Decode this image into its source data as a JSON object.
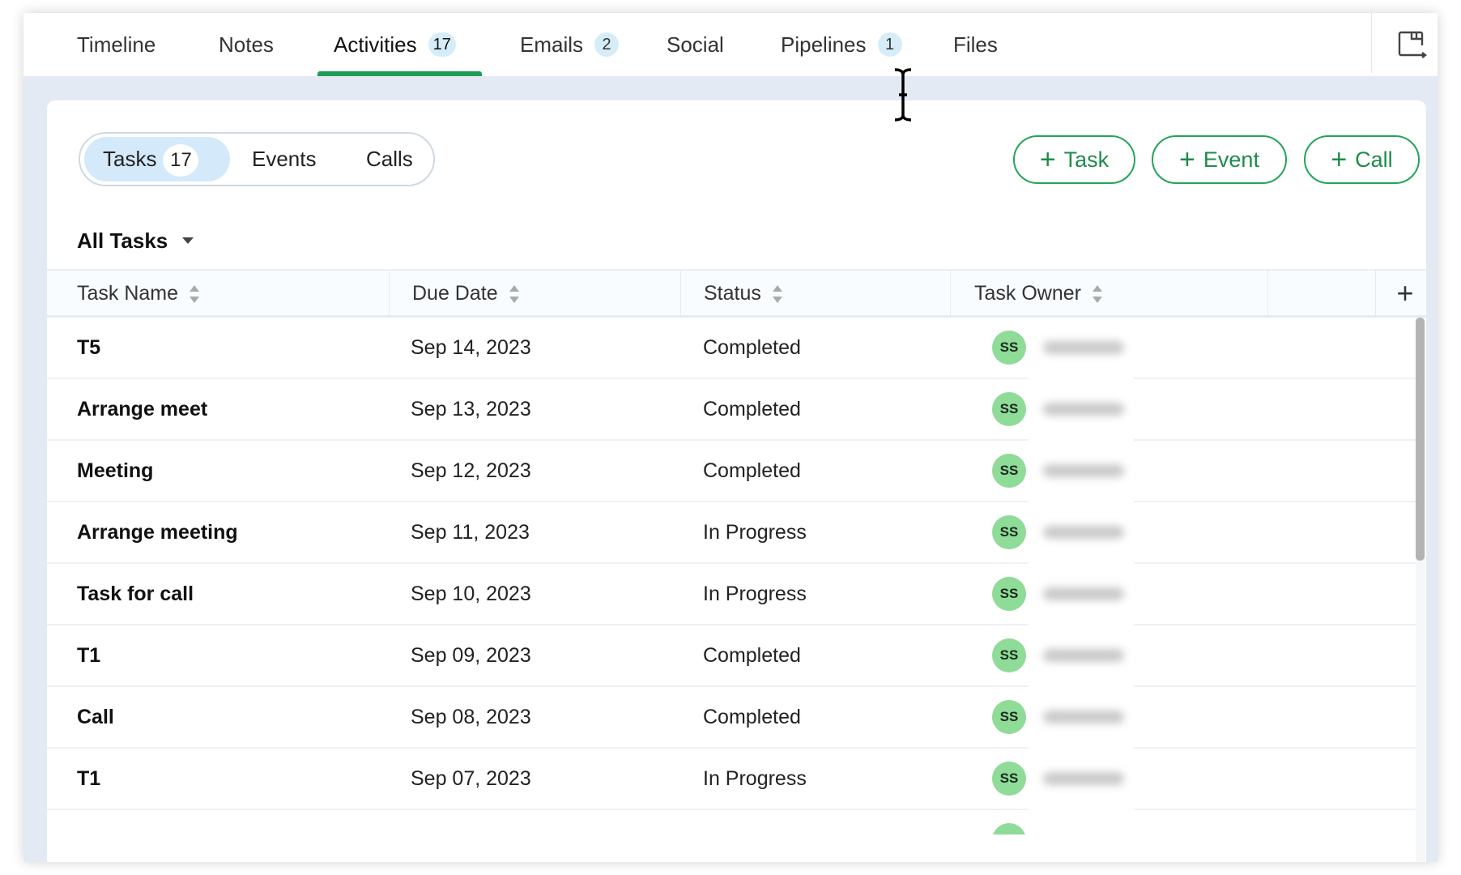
{
  "tabs": [
    {
      "label": "Timeline"
    },
    {
      "label": "Notes"
    },
    {
      "label": "Activities",
      "badge": "17",
      "active": true
    },
    {
      "label": "Emails",
      "badge": "2"
    },
    {
      "label": "Social"
    },
    {
      "label": "Pipelines",
      "badge": "1"
    },
    {
      "label": "Files"
    }
  ],
  "icons": {
    "panel": "panel-toggle-icon",
    "sort": "sort-icon",
    "add_column": "plus-icon",
    "caret": "chevron-down-icon"
  },
  "segments": {
    "tasks": "Tasks",
    "tasks_count": "17",
    "events": "Events",
    "calls": "Calls"
  },
  "actions": {
    "task": "Task",
    "event": "Event",
    "call": "Call",
    "plus": "+"
  },
  "filter": {
    "label": "All Tasks"
  },
  "columns": {
    "task_name": "Task Name",
    "due_date": "Due Date",
    "status": "Status",
    "task_owner": "Task Owner",
    "add": "+"
  },
  "colors": {
    "accent": "#1f9d55",
    "badge_bg": "#d6edf9",
    "avatar": "#8fdb98",
    "band": "#e3eaf3"
  },
  "rows": [
    {
      "name": "T5",
      "date": "Sep 14, 2023",
      "status": "Completed",
      "owner_initials": "SS"
    },
    {
      "name": "Arrange meet",
      "date": "Sep 13, 2023",
      "status": "Completed",
      "owner_initials": "SS"
    },
    {
      "name": "Meeting",
      "date": "Sep 12, 2023",
      "status": "Completed",
      "owner_initials": "SS"
    },
    {
      "name": "Arrange meeting",
      "date": "Sep 11, 2023",
      "status": "In Progress",
      "owner_initials": "SS"
    },
    {
      "name": "Task for call",
      "date": "Sep 10, 2023",
      "status": "In Progress",
      "owner_initials": "SS"
    },
    {
      "name": "T1",
      "date": "Sep 09, 2023",
      "status": "Completed",
      "owner_initials": "SS"
    },
    {
      "name": "Call",
      "date": "Sep 08, 2023",
      "status": "Completed",
      "owner_initials": "SS"
    },
    {
      "name": "T1",
      "date": "Sep 07, 2023",
      "status": "In Progress",
      "owner_initials": "SS"
    }
  ]
}
